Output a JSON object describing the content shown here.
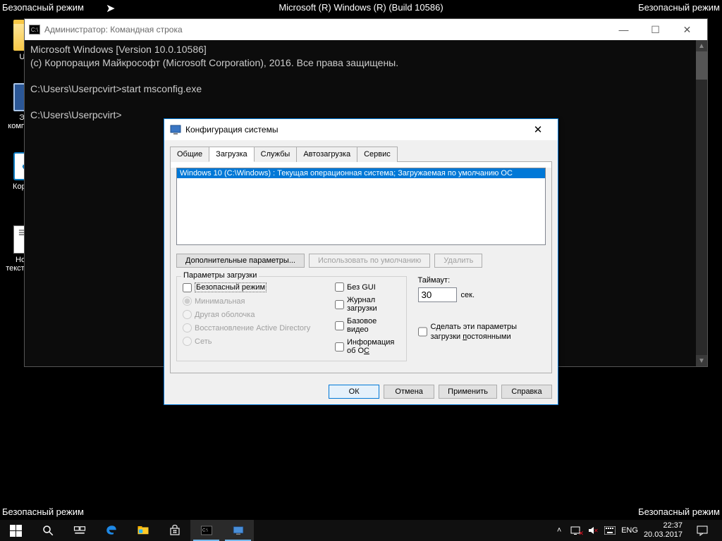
{
  "safemode_label": "Безопасный режим",
  "build_label": "Microsoft (R) Windows (R) (Build 10586)",
  "desktop": {
    "user_folder": "User",
    "this_pc": "Этот компьютер",
    "recycle": "Корзина",
    "textfile": "Новый текстовый..."
  },
  "cmd": {
    "title": "Администратор: Командная строка",
    "line1": "Microsoft Windows [Version 10.0.10586]",
    "line2": "(c) Корпорация Майкрософт (Microsoft Corporation), 2016. Все права защищены.",
    "line3": "C:\\Users\\Userpcvirt>start msconfig.exe",
    "line4": "C:\\Users\\Userpcvirt>"
  },
  "msconfig": {
    "title": "Конфигурация системы",
    "tabs": {
      "general": "Общие",
      "boot": "Загрузка",
      "services": "Службы",
      "startup": "Автозагрузка",
      "tools": "Сервис"
    },
    "os_entry": "Windows 10 (C:\\Windows) : Текущая операционная система; Загружаемая по умолчанию ОС",
    "adv_opts": "Дополнительные параметры...",
    "set_default": "Использовать по умолчанию",
    "delete": "Удалить",
    "boot_group": "Параметры загрузки",
    "safe_boot": "Безопасный режим",
    "minimal": "Минимальная",
    "altshell": "Другая оболочка",
    "dsrepair": "Восстановление Active Directory",
    "network": "Сеть",
    "nogui": "Без GUI",
    "bootlog": "Журнал загрузки",
    "basevideo": "Базовое видео",
    "osinfo_pre": "Информация  об О",
    "osinfo_und": "С",
    "timeout_label": "Таймаут:",
    "timeout_value": "30",
    "timeout_unit": "сек.",
    "permanent_line1": "Сделать эти параметры",
    "permanent_line2_a": "загрузки ",
    "permanent_line2_b": "п",
    "permanent_line2_c": "остоянными",
    "ok": "ОК",
    "cancel": "Отмена",
    "apply": "Применить",
    "help": "Справка"
  },
  "tray": {
    "lang": "ENG",
    "time": "22:37",
    "date": "20.03.2017"
  }
}
